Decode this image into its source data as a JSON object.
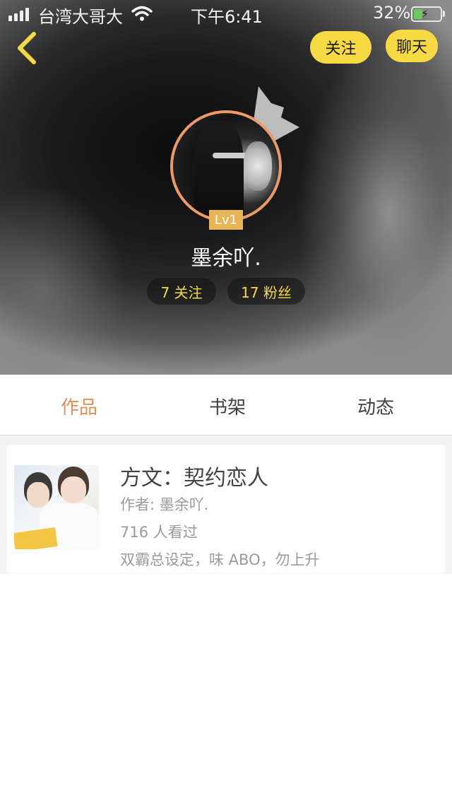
{
  "status_bar": {
    "carrier": "台湾大哥大",
    "time": "下午6:41",
    "battery": "32%",
    "battery_level": 0.32
  },
  "header": {
    "follow_label": "关注",
    "chat_label": "聊天",
    "level": "Lv1",
    "username": "墨余吖.",
    "following": "7 关注",
    "fans": "17 粉丝"
  },
  "tabs": [
    {
      "label": "作品",
      "active": true
    },
    {
      "label": "书架",
      "active": false
    },
    {
      "label": "动态",
      "active": false
    }
  ],
  "works": [
    {
      "title": "方文：契约恋人",
      "author": "作者: 墨余吖.",
      "views": "716 人看过",
      "description": "双霸总设定，味 ABO，勿上升"
    }
  ],
  "colors": {
    "accent": "#e48d57",
    "yellow": "#f6d943",
    "avatar_border": "#e99b6b",
    "level_badge": "#e7b556"
  }
}
